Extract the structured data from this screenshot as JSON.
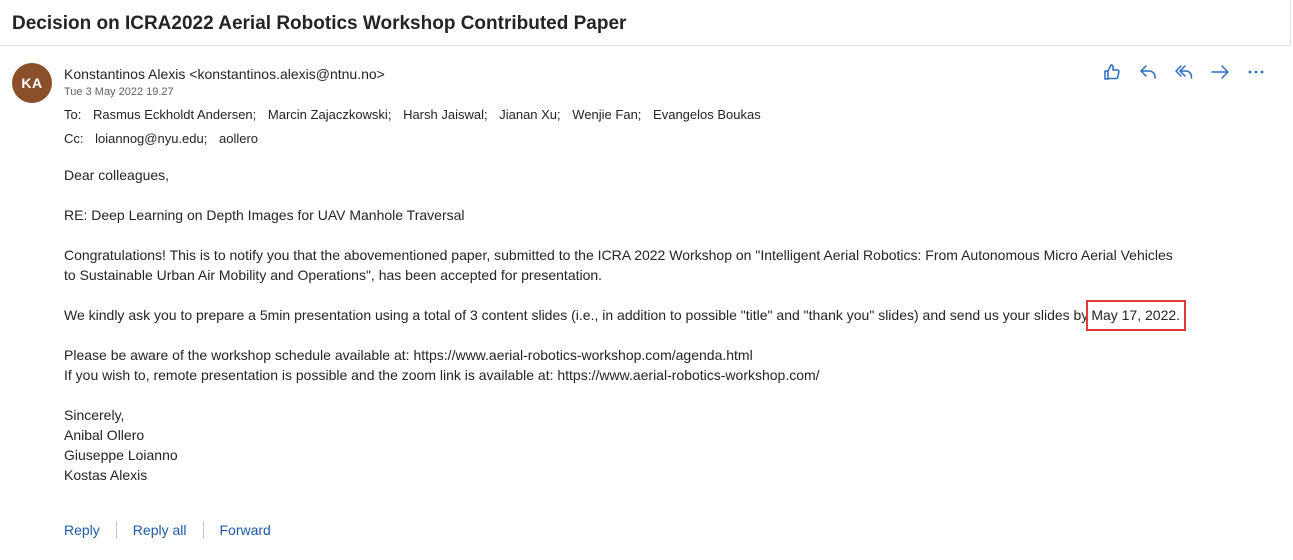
{
  "subject": "Decision on ICRA2022 Aerial Robotics Workshop Contributed Paper",
  "avatar_initials": "KA",
  "avatar_color": "#8b4f2a",
  "sender": "Konstantinos Alexis <konstantinos.alexis@ntnu.no>",
  "date": "Tue 3 May 2022 19.27",
  "to_label": "To:",
  "to": [
    "Rasmus Eckholdt Andersen;",
    "Marcin Zajaczkowski;",
    "Harsh Jaiswal;",
    "Jianan Xu;",
    "Wenjie Fan;",
    "Evangelos Boukas"
  ],
  "cc_label": "Cc:",
  "cc": [
    "loiannog@nyu.edu;",
    "aollero"
  ],
  "actions": {
    "like": "thumbs-up-icon",
    "reply": "reply-icon",
    "reply_all": "reply-all-icon",
    "forward": "forward-arrow-icon",
    "more": "more-icon"
  },
  "body": {
    "greeting": "Dear colleagues,",
    "re_line": "RE: Deep Learning on Depth Images for UAV Manhole Traversal",
    "para1_line1": "Congratulations! This is to notify you that the abovementioned paper, submitted to the ICRA 2022 Workshop on \"Intelligent Aerial Robotics: From Autonomous Micro Aerial Vehicles",
    "para1_line2": "to Sustainable Urban Air Mobility and Operations\", has been accepted for presentation.",
    "para2_prefix": "We kindly ask you to prepare a 5min presentation using a total of 3 content slides (i.e., in addition to possible \"title\" and \"thank you\" slides) and send us your slides by",
    "para2_deadline": "May 17, 2022.",
    "para3_line1": "Please be aware of the workshop schedule available at: https://www.aerial-robotics-workshop.com/agenda.html",
    "para3_line2": "If you wish to, remote presentation is possible and the zoom link is available at: https://www.aerial-robotics-workshop.com/",
    "closing": "Sincerely,",
    "sig1": "Anibal Ollero",
    "sig2": "Giuseppe Loianno",
    "sig3": "Kostas Alexis"
  },
  "footer": {
    "reply": "Reply",
    "reply_all": "Reply all",
    "forward": "Forward"
  },
  "accent_color": "#2b6cc4",
  "highlight_color": "#e03a3a"
}
